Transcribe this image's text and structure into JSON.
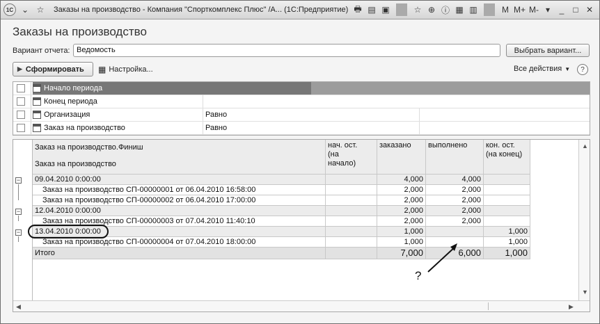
{
  "window": {
    "title": "Заказы на производство - Компания \"Спорткомплекс Плюс\" /А...  (1С:Предприятие)",
    "logo": "1С",
    "right_tools": [
      "M",
      "M+",
      "M-"
    ]
  },
  "form": {
    "title": "Заказы на производство",
    "variant_label": "Вариант отчета:",
    "variant_value": "Ведомость",
    "choose_variant": "Выбрать вариант...",
    "generate": "Сформировать",
    "settings": "Настройка...",
    "all_actions": "Все действия",
    "help": "?"
  },
  "settings_rows": [
    {
      "name": "Начало периода",
      "condition": "",
      "selected": true
    },
    {
      "name": "Конец периода",
      "condition": ""
    },
    {
      "name": "Организация",
      "condition": "Равно"
    },
    {
      "name": "Заказ на производство",
      "condition": "Равно"
    }
  ],
  "report": {
    "headers": {
      "h1": "Заказ на производство.Финиш",
      "h2": "Заказ на производство",
      "start": "нач. ост.\n(на\nначало)",
      "ordered": "заказано",
      "done": "выполнено",
      "end": "кон. ост.\n(на конец)"
    },
    "rows": [
      {
        "text": "09.04.2010 0:00:00",
        "start": "",
        "ordered": "4,000",
        "done": "4,000",
        "end": "",
        "group": true
      },
      {
        "text": "Заказ на производство СП-00000001 от 06.04.2010 16:58:00",
        "start": "",
        "ordered": "2,000",
        "done": "2,000",
        "end": ""
      },
      {
        "text": "Заказ на производство СП-00000002 от 06.04.2010 17:00:00",
        "start": "",
        "ordered": "2,000",
        "done": "2,000",
        "end": ""
      },
      {
        "text": "12.04.2010 0:00:00",
        "start": "",
        "ordered": "2,000",
        "done": "2,000",
        "end": "",
        "group": true
      },
      {
        "text": "Заказ на производство СП-00000003 от 07.04.2010 11:40:10",
        "start": "",
        "ordered": "2,000",
        "done": "2,000",
        "end": ""
      },
      {
        "text": "13.04.2010 0:00:00",
        "start": "",
        "ordered": "1,000",
        "done": "",
        "end": "1,000",
        "group": true
      },
      {
        "text": "Заказ на производство СП-00000004 от 07.04.2010 18:00:00",
        "start": "",
        "ordered": "1,000",
        "done": "",
        "end": "1,000"
      }
    ],
    "total": {
      "text": "Итого",
      "start": "",
      "ordered": "7,000",
      "done": "6,000",
      "end": "1,000"
    }
  },
  "annotation": {
    "question": "?"
  }
}
